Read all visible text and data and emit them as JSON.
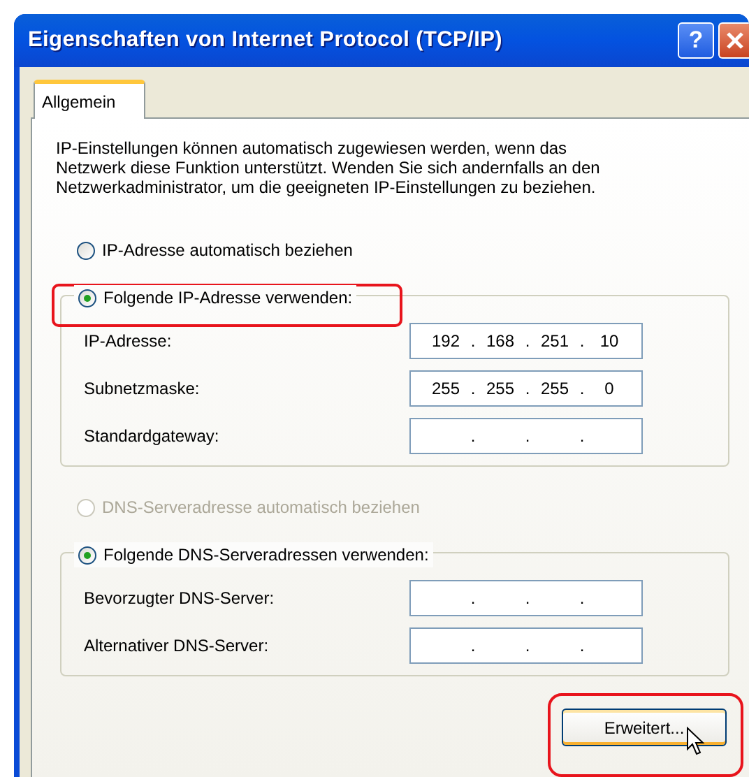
{
  "window": {
    "title": "Eigenschaften von Internet Protocol (TCP/IP)",
    "buttons": [
      {
        "kind": "help",
        "label": "?"
      },
      {
        "kind": "close"
      }
    ]
  },
  "tabs": [
    {
      "label": "Allgemein",
      "selected": true
    }
  ],
  "description": "IP-Einstellungen können automatisch zugewiesen werden, wenn das Netzwerk diese Funktion unterstützt. Wenden Sie sich andernfalls an den Netzwerkadministrator, um die geeigneten IP-Einstellungen zu beziehen.",
  "ip_section": {
    "auto_option": {
      "label": "IP-Adresse automatisch beziehen",
      "selected": false,
      "disabled": false
    },
    "manual_option": {
      "label": "Folgende IP-Adresse verwenden:",
      "selected": true,
      "disabled": false,
      "highlighted": true
    },
    "fields": [
      {
        "label": "IP-Adresse:",
        "octets": [
          "192",
          "168",
          "251",
          "10"
        ],
        "separators": [
          ".",
          ".",
          "."
        ]
      },
      {
        "label": "Subnetzmaske:",
        "octets": [
          "255",
          "255",
          "255",
          "0"
        ],
        "separators": [
          ".",
          ".",
          "."
        ]
      },
      {
        "label": "Standardgateway:",
        "separators": [
          ".",
          ".",
          "."
        ]
      }
    ]
  },
  "dns_section": {
    "auto_option": {
      "label": "DNS-Serveradresse automatisch beziehen",
      "selected": false,
      "disabled": true
    },
    "manual_option": {
      "label": "Folgende DNS-Serveradressen verwenden:",
      "selected": true,
      "disabled": false,
      "highlighted": false
    },
    "fields": [
      {
        "label": "Bevorzugter DNS-Server:",
        "separators": [
          ".",
          ".",
          "."
        ]
      },
      {
        "label": "Alternativer DNS-Server:",
        "separators": [
          ".",
          ".",
          "."
        ]
      }
    ]
  },
  "advanced_button": {
    "label": "Erweitert...",
    "highlighted": true,
    "hovered": true
  }
}
